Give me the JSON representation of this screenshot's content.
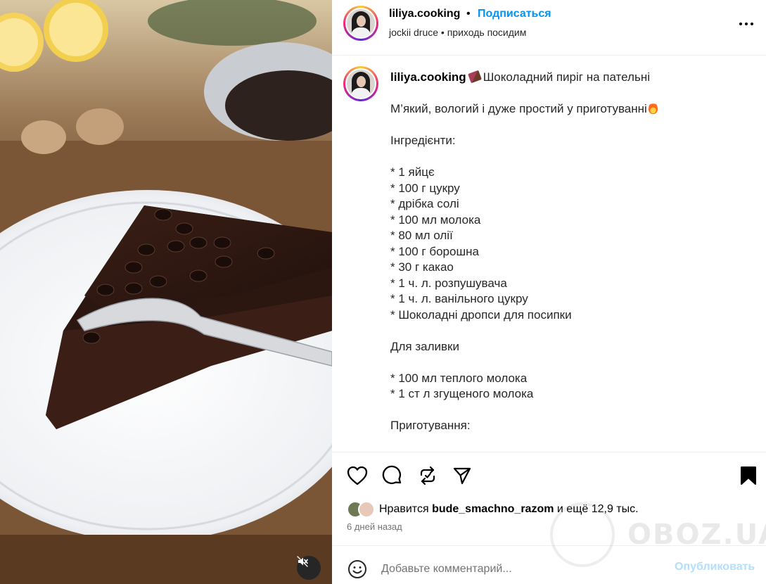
{
  "header": {
    "username": "liliya.cooking",
    "separator": "•",
    "follow_label": "Подписаться",
    "audio_line": "jockii druce • приходь посидим",
    "more_icon": "more-options-icon"
  },
  "caption": {
    "username": "liliya.cooking",
    "title": "Шоколадний пиріг на пательні",
    "intro": "М’який, вологий і дуже простий у приготуванні",
    "ingredients_heading": "Інгредієнти:",
    "ingredients": [
      "* 1 яйцє",
      "* 100 г цукру",
      "* дрібка солі",
      "* 100 мл молока",
      "* 80 мл олії",
      "* 100 г борошна",
      "* 30 г какао",
      "* 1 ч. л. розпушувача",
      "* 1 ч. л. ванільного цукру",
      "* Шоколадні дропси для посипки"
    ],
    "topping_heading": "Для заливки",
    "topping": [
      "* 100 мл теплого молока",
      "* 1 ст л згущеного молока"
    ],
    "method_heading": "Приготування:"
  },
  "actions": {
    "like_icon": "heart-icon",
    "comment_icon": "comment-bubble-icon",
    "repost_icon": "repost-icon",
    "share_icon": "send-icon",
    "save_icon": "bookmark-filled-icon"
  },
  "likes": {
    "prefix": "Нравится",
    "user": "bude_smachno_razom",
    "suffix": "и ещё 12,9 тыс."
  },
  "timestamp": "6 дней назад",
  "comment": {
    "placeholder": "Добавьте комментарий...",
    "publish_label": "Опубликовать"
  },
  "watermark": {
    "text": "OBOZ.UA"
  },
  "media": {
    "mute_icon": "sound-off-icon"
  },
  "colors": {
    "link_blue": "#0095f6",
    "publish_disabled": "#b2dffc",
    "muted_text": "#737373"
  }
}
